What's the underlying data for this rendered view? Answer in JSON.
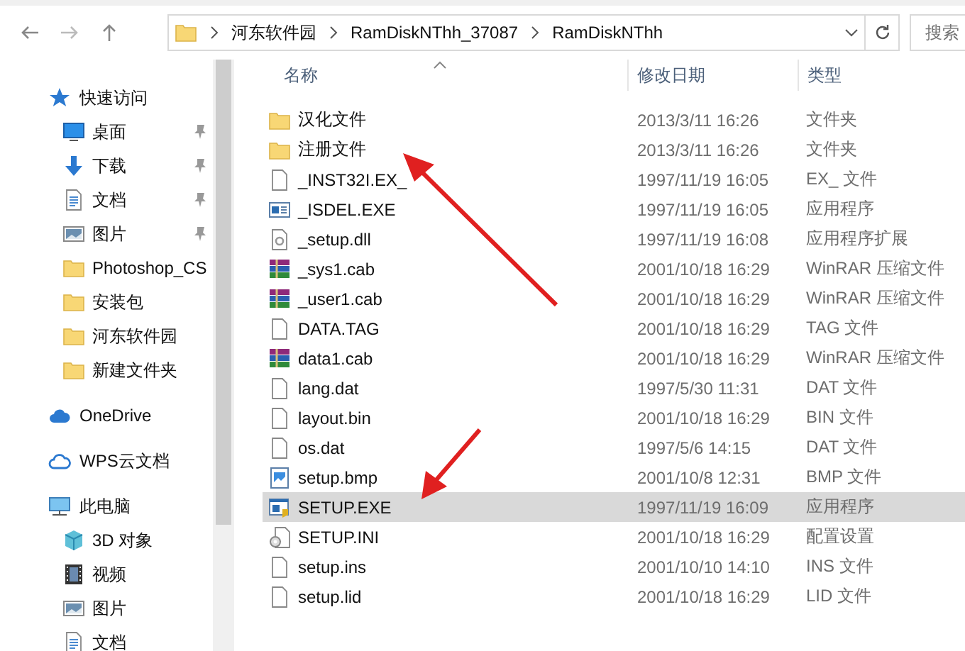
{
  "address_bar": {
    "path": [
      {
        "label": "河东软件园"
      },
      {
        "label": "RamDiskNThh_37087"
      },
      {
        "label": "RamDiskNThh"
      }
    ]
  },
  "search": {
    "placeholder": "搜索"
  },
  "sidebar": {
    "items": [
      {
        "label": "快速访问",
        "kind": "star",
        "children": [
          {
            "label": "桌面",
            "kind": "desktop",
            "pinned": true
          },
          {
            "label": "下载",
            "kind": "download",
            "pinned": true
          },
          {
            "label": "文档",
            "kind": "document",
            "pinned": true
          },
          {
            "label": "图片",
            "kind": "picture",
            "pinned": true
          },
          {
            "label": "Photoshop_CS",
            "kind": "folder",
            "pinned": false
          },
          {
            "label": "安装包",
            "kind": "folder",
            "pinned": false
          },
          {
            "label": "河东软件园",
            "kind": "folder",
            "pinned": false
          },
          {
            "label": "新建文件夹",
            "kind": "folder",
            "pinned": false
          }
        ]
      },
      {
        "label": "OneDrive",
        "kind": "cloud"
      },
      {
        "label": "WPS云文档",
        "kind": "cloud-outline"
      },
      {
        "label": "此电脑",
        "kind": "computer",
        "children": [
          {
            "label": "3D 对象",
            "kind": "cube",
            "pinned": false
          },
          {
            "label": "视频",
            "kind": "video",
            "pinned": false
          },
          {
            "label": "图片",
            "kind": "picture",
            "pinned": false
          },
          {
            "label": "文档",
            "kind": "document",
            "pinned": false
          }
        ]
      }
    ]
  },
  "table": {
    "columns": [
      "名称",
      "修改日期",
      "类型"
    ],
    "rows": [
      {
        "name": "汉化文件",
        "date": "2013/3/11 16:26",
        "type": "文件夹",
        "kind": "folder",
        "selected": false
      },
      {
        "name": "注册文件",
        "date": "2013/3/11 16:26",
        "type": "文件夹",
        "kind": "folder",
        "selected": false
      },
      {
        "name": "_INST32I.EX_",
        "date": "1997/11/19 16:05",
        "type": "EX_ 文件",
        "kind": "file",
        "selected": false
      },
      {
        "name": "_ISDEL.EXE",
        "date": "1997/11/19 16:05",
        "type": "应用程序",
        "kind": "app",
        "selected": false
      },
      {
        "name": "_setup.dll",
        "date": "1997/11/19 16:08",
        "type": "应用程序扩展",
        "kind": "dll",
        "selected": false
      },
      {
        "name": "_sys1.cab",
        "date": "2001/10/18 16:29",
        "type": "WinRAR 压缩文件",
        "kind": "archive",
        "selected": false
      },
      {
        "name": "_user1.cab",
        "date": "2001/10/18 16:29",
        "type": "WinRAR 压缩文件",
        "kind": "archive",
        "selected": false
      },
      {
        "name": "DATA.TAG",
        "date": "2001/10/18 16:29",
        "type": "TAG 文件",
        "kind": "file",
        "selected": false
      },
      {
        "name": "data1.cab",
        "date": "2001/10/18 16:29",
        "type": "WinRAR 压缩文件",
        "kind": "archive",
        "selected": false
      },
      {
        "name": "lang.dat",
        "date": "1997/5/30 11:31",
        "type": "DAT 文件",
        "kind": "file",
        "selected": false
      },
      {
        "name": "layout.bin",
        "date": "2001/10/18 16:29",
        "type": "BIN 文件",
        "kind": "file",
        "selected": false
      },
      {
        "name": "os.dat",
        "date": "1997/5/6 14:15",
        "type": "DAT 文件",
        "kind": "file",
        "selected": false
      },
      {
        "name": "setup.bmp",
        "date": "2001/10/8 12:31",
        "type": "BMP 文件",
        "kind": "image",
        "selected": false
      },
      {
        "name": "SETUP.EXE",
        "date": "1997/11/19 16:09",
        "type": "应用程序",
        "kind": "setup",
        "selected": true
      },
      {
        "name": "SETUP.INI",
        "date": "2001/10/18 16:29",
        "type": "配置设置",
        "kind": "config",
        "selected": false
      },
      {
        "name": "setup.ins",
        "date": "2001/10/10 14:10",
        "type": "INS 文件",
        "kind": "file",
        "selected": false
      },
      {
        "name": "setup.lid",
        "date": "2001/10/18 16:29",
        "type": "LID 文件",
        "kind": "file",
        "selected": false
      }
    ]
  }
}
